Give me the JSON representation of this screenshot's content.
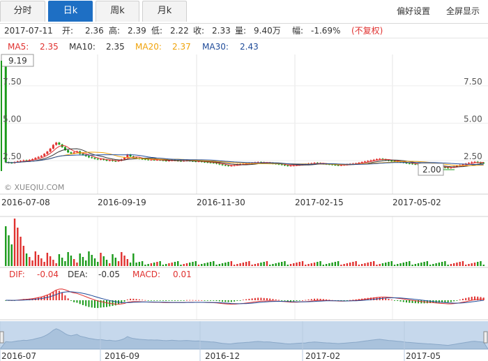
{
  "tabs": [
    {
      "label": "分时",
      "active": false
    },
    {
      "label": "日k",
      "active": true
    },
    {
      "label": "周k",
      "active": false
    },
    {
      "label": "月k",
      "active": false
    }
  ],
  "links": {
    "prefs": "偏好设置",
    "fullscreen": "全屏显示"
  },
  "info": {
    "date": "2017-07-11",
    "open_label": "开:",
    "open": "2.36",
    "high_label": "高:",
    "high": "2.39",
    "low_label": "低:",
    "low": "2.22",
    "close_label": "收:",
    "close": "2.33",
    "volume_label": "量:",
    "volume": "9.40万",
    "change_label": "幅:",
    "change": "-1.69%",
    "adjust": "(不复权)"
  },
  "ma": {
    "ma5_label": "MA5:",
    "ma5": "2.35",
    "ma10_label": "MA10:",
    "ma10": "2.35",
    "ma20_label": "MA20:",
    "ma20": "2.37",
    "ma30_label": "MA30:",
    "ma30": "2.43"
  },
  "macd": {
    "dif_label": "DIF:",
    "dif": "-0.04",
    "dea_label": "DEA:",
    "dea": "-0.05",
    "macd_label": "MACD:",
    "macd": "0.01"
  },
  "watermark": "© XUEQIU.COM",
  "callouts": {
    "max": "9.19",
    "min": "2.00"
  },
  "colors": {
    "up": "#e0312f",
    "down": "#1a9a1a",
    "accent": "#1e6fc4",
    "ma5": "#e0312f",
    "ma10": "#333333",
    "ma20": "#f0a30a",
    "ma30": "#1f4b99",
    "navigator": "#c6d8ec"
  },
  "chart_data": {
    "type": "candlestick",
    "title": "",
    "y_ticks_left": [
      "9.19",
      "7.50",
      "5.00",
      "2.50"
    ],
    "y_ticks_right": [
      "7.50",
      "5.00",
      "2.50"
    ],
    "ylim": [
      1.8,
      9.5
    ],
    "x_tick_labels": [
      "2016-07-08",
      "2016-09-19",
      "2016-11-30",
      "2017-02-15",
      "2017-05-02"
    ],
    "navigator_labels": [
      "2016-07",
      "2016-09",
      "2016-12",
      "2017-02",
      "2017-05"
    ],
    "max_price": 9.19,
    "min_price": 2.0,
    "close_series": [
      9.19,
      2.38,
      2.36,
      2.34,
      2.4,
      2.45,
      2.48,
      2.52,
      2.5,
      2.55,
      2.6,
      2.68,
      2.75,
      2.82,
      2.95,
      3.1,
      3.3,
      3.55,
      3.7,
      3.58,
      3.4,
      3.2,
      3.05,
      2.98,
      3.05,
      3.12,
      2.95,
      2.88,
      2.8,
      2.72,
      2.68,
      2.62,
      2.58,
      2.6,
      2.55,
      2.5,
      2.52,
      2.48,
      2.46,
      2.5,
      2.58,
      2.7,
      2.9,
      2.78,
      2.7,
      2.66,
      2.62,
      2.6,
      2.58,
      2.55,
      2.56,
      2.54,
      2.55,
      2.53,
      2.5,
      2.48,
      2.5,
      2.52,
      2.5,
      2.48,
      2.47,
      2.49,
      2.5,
      2.48,
      2.46,
      2.44,
      2.45,
      2.42,
      2.4,
      2.38,
      2.36,
      2.35,
      2.3,
      2.25,
      2.2,
      2.18,
      2.15,
      2.16,
      2.2,
      2.24,
      2.26,
      2.28,
      2.3,
      2.32,
      2.35,
      2.38,
      2.4,
      2.38,
      2.35,
      2.36,
      2.34,
      2.3,
      2.28,
      2.25,
      2.22,
      2.18,
      2.15,
      2.16,
      2.18,
      2.2,
      2.22,
      2.24,
      2.25,
      2.3,
      2.32,
      2.35,
      2.33,
      2.3,
      2.28,
      2.26,
      2.25,
      2.22,
      2.2,
      2.18,
      2.2,
      2.22,
      2.25,
      2.28,
      2.3,
      2.32,
      2.36,
      2.4,
      2.44,
      2.48,
      2.52,
      2.56,
      2.6,
      2.62,
      2.58,
      2.54,
      2.5,
      2.48,
      2.45,
      2.42,
      2.4,
      2.36,
      2.32,
      2.3,
      2.28,
      2.25,
      2.22,
      2.2,
      2.18,
      2.16,
      2.15,
      2.12,
      2.1,
      2.08,
      2.05,
      2.03,
      2.0,
      2.05,
      2.1,
      2.15,
      2.2,
      2.25,
      2.3,
      2.35,
      2.4,
      2.42,
      2.38,
      2.36,
      2.33
    ]
  }
}
